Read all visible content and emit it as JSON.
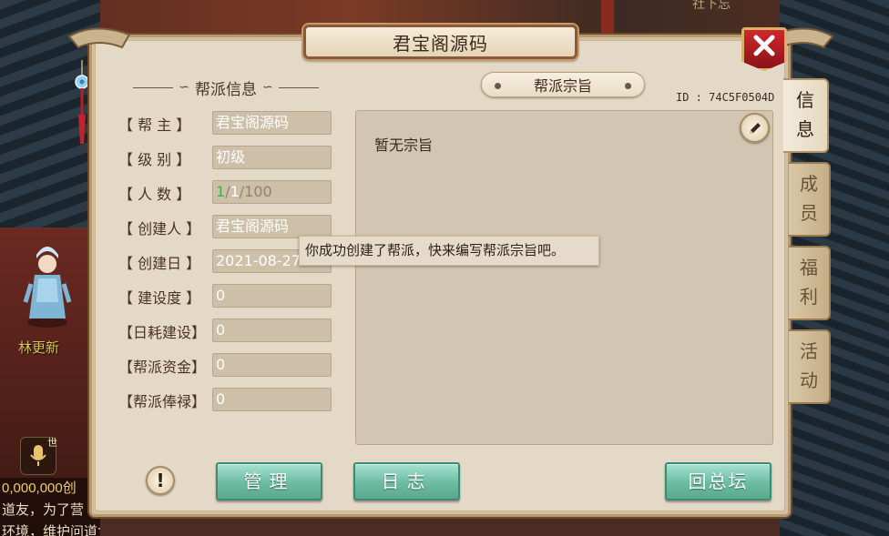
{
  "window": {
    "title": "君宝阁源码",
    "close_label": "✕"
  },
  "background": {
    "npc_name": "林更新",
    "top_right_text": "社下忘",
    "world_tag": "世",
    "chat_lines": [
      "0,000,000创",
      "道友，为了营",
      "环境，维护问道世界的正"
    ]
  },
  "info_section": {
    "heading": "帮派信息",
    "rows": [
      {
        "label": "【  帮  主  】",
        "value": "君宝阁源码"
      },
      {
        "label": "【  级  别  】",
        "value": "初级"
      },
      {
        "label": "【  人  数  】",
        "members_online": "1",
        "members_current": "1",
        "members_max": "100"
      },
      {
        "label": "【  创建人  】",
        "value": "君宝阁源码"
      },
      {
        "label": "【  创建日  】",
        "value": "2021-08-27"
      },
      {
        "label": "【  建设度  】",
        "value": "0"
      },
      {
        "label": "【日耗建设】",
        "value": "0"
      },
      {
        "label": "【帮派资金】",
        "value": "0"
      },
      {
        "label": "【帮派俸禄】",
        "value": "0"
      }
    ]
  },
  "purpose_section": {
    "tab_label": "帮派宗旨",
    "guild_id": "ID : 74C5F0504D",
    "text": "暂无宗旨",
    "tooltip": "你成功创建了帮派，快来编写帮派宗旨吧。"
  },
  "side_tabs": [
    {
      "label_1": "信",
      "label_2": "息",
      "active": true
    },
    {
      "label_1": "成",
      "label_2": "员",
      "active": false
    },
    {
      "label_1": "福",
      "label_2": "利",
      "active": false
    },
    {
      "label_1": "活",
      "label_2": "动",
      "active": false
    }
  ],
  "buttons": {
    "warning": "!",
    "manage": "管理",
    "log": "日志",
    "return": "回总坛"
  },
  "colors": {
    "panel_bg": "#e4d9c6",
    "button_green": "#6cbba2",
    "close_red": "#d0282b",
    "member_online": "#39b34a"
  }
}
